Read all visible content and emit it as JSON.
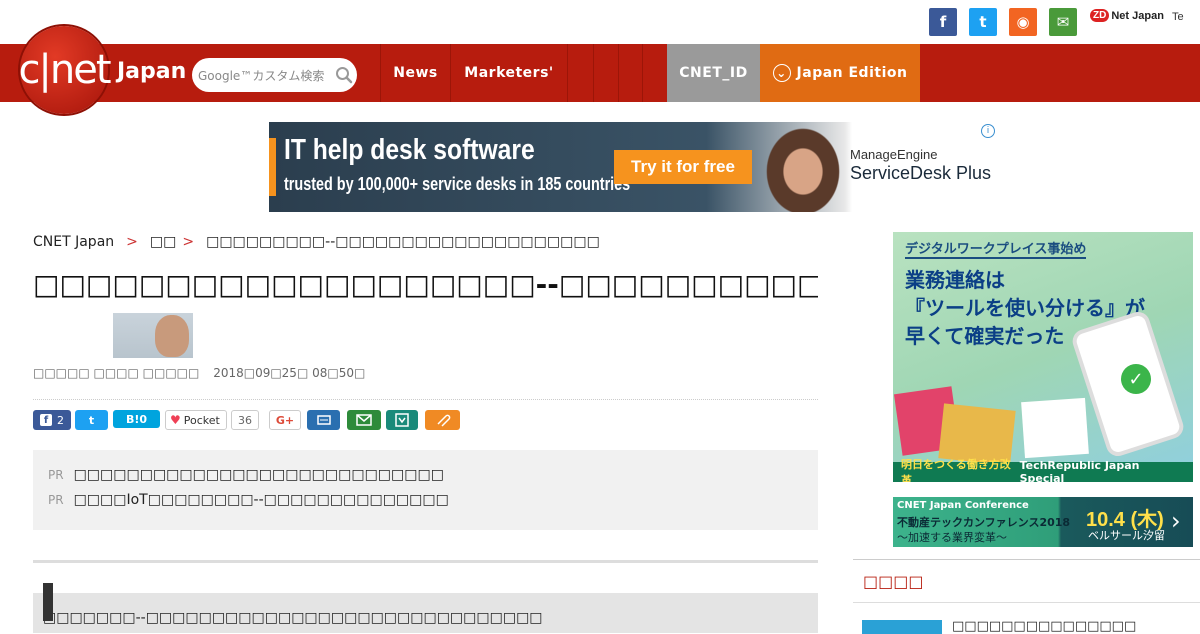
{
  "header": {
    "social": [
      {
        "name": "facebook-icon",
        "glyph": "f",
        "color": "#3b5998"
      },
      {
        "name": "twitter-icon",
        "glyph": "t",
        "color": "#1da1f2"
      },
      {
        "name": "rss-icon",
        "glyph": "◉",
        "color": "#f26522"
      },
      {
        "name": "mail-icon",
        "glyph": "✉",
        "color": "#4a9a3a"
      }
    ],
    "zdnet_badge": "ZD",
    "zdnet_label": "Net Japan",
    "techrepublic_label": "Te"
  },
  "nav": {
    "logo_text": "c|net",
    "logo_suffix": "Japan",
    "search_placeholder": "Google™カスタム検索",
    "items": [
      "News",
      "Marketers'"
    ],
    "cnet_id": "CNET_ID",
    "edition": "Japan Edition",
    "edition_icon": "⌄",
    "colors": {
      "bar": "#b71c0e",
      "cnet_id": "#9a9a9a",
      "edition": "#e06b13"
    }
  },
  "top_ad": {
    "headline": "IT help desk software",
    "subline": "trusted by 100,000+ service desks in 185 countries",
    "cta": "Try it for free",
    "brand_line1": "ManageEngine",
    "brand_line2": "ServiceDesk Plus",
    "info": "i"
  },
  "breadcrumb": {
    "home": "CNET Japan",
    "sep1": ">",
    "section": "□□",
    "sep2": ">",
    "current": "□□□□□□□□□--□□□□□□□□□□□□□□□□□□□□"
  },
  "article": {
    "title": "□□□□□□□□□□□□□□□□□□□--□□□□□□□□□□□",
    "byline": "□□□□□ □□□□ □□□□□",
    "date": "2018□09□25□ 08□50□"
  },
  "share": {
    "facebook_count": "2",
    "twitter": "t",
    "hatena": "B!0",
    "pocket": "Pocket",
    "pocket_count": "36",
    "gplus": "G+"
  },
  "pr": {
    "tag": "PR",
    "items": [
      "□□□□□□□□□□□□□□□□□□□□□□□□□□□□",
      "□□□□IoT□□□□□□□□--□□□□□□□□□□□□□□"
    ]
  },
  "lead": {
    "text": "□□□□□□□--□□□□□□□□□□□□□□□□□□□□□□□□□□□□□□"
  },
  "side_ad1": {
    "kicker": "デジタルワークプレイス事始め",
    "line1": "業務連絡は",
    "line2": "『ツールを使い分ける』が",
    "line3": "早くて確実だった",
    "check": "✓",
    "foot_left": "明日をつくる働き方改革",
    "foot_right": "TechRepublic Japan Special"
  },
  "side_ad2": {
    "title": "CNET Japan Conference",
    "line1": "不動産テックカンファレンス2018",
    "line2": "～加速する業界変革～",
    "date": "10.4 (木)",
    "venue": "ベルサール汐留",
    "chevron": "›"
  },
  "sidebar": {
    "heading": "□□□□",
    "item1": "□□□□□□□□□□□□□□□"
  }
}
